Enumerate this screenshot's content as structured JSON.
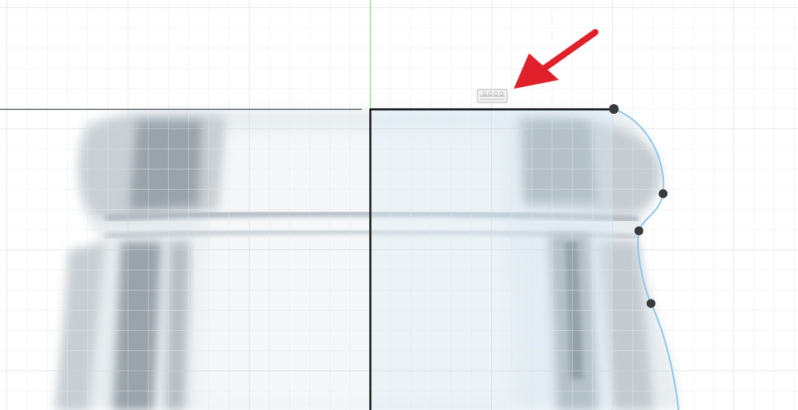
{
  "app": {
    "view": "sketch-canvas"
  },
  "canvas": {
    "background": "#ffffff",
    "grid_minor_color": "#e4e7ea",
    "grid_major_color": "#cfd4d8",
    "axis_vertical_color": "#a6dc9a",
    "sketch_line_color": "#1a1a1a",
    "spline_color": "#8fc8ea",
    "point_color": "#3a3a3a",
    "arrow_color": "#e0202a"
  },
  "sketch": {
    "profile": {
      "points_count": 4
    },
    "constraint_glyph": "horizontal-constraint-icon"
  },
  "annotation": {
    "arrow": "red-annotation-arrow"
  }
}
